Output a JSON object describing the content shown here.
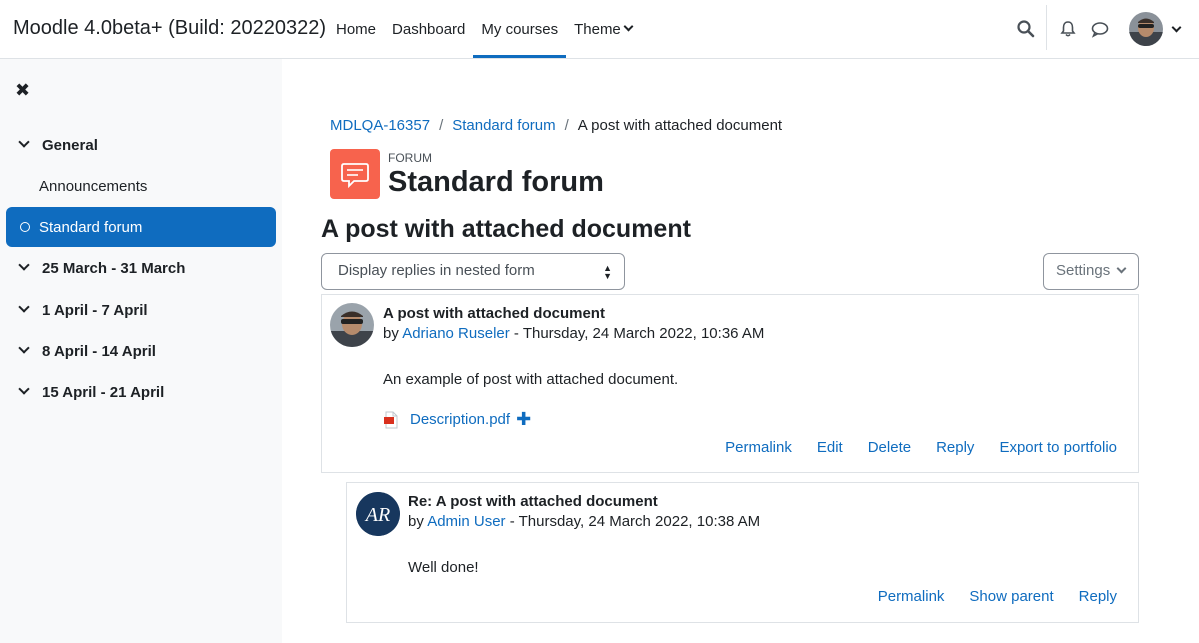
{
  "navbar": {
    "brand": "Moodle 4.0beta+ (Build: 20220322)",
    "links": [
      {
        "label": "Home"
      },
      {
        "label": "Dashboard"
      },
      {
        "label": "My courses",
        "active": true
      },
      {
        "label": "Theme",
        "dropdown": true
      }
    ],
    "icons": [
      "search-icon",
      "bell-icon",
      "message-icon"
    ]
  },
  "drawer": {
    "close_icon": "✖",
    "sections": [
      {
        "label": "General"
      },
      {
        "label": "25 March - 31 March"
      },
      {
        "label": "1 April - 7 April"
      },
      {
        "label": "8 April - 14 April"
      },
      {
        "label": "15 April - 21 April"
      }
    ],
    "activities": [
      {
        "label": "Announcements"
      },
      {
        "label": "Standard forum",
        "active": true
      }
    ]
  },
  "breadcrumb": [
    "MDLQA-16357",
    "Standard forum",
    "A post with attached document"
  ],
  "forum": {
    "label": "FORUM",
    "title": "Standard forum",
    "icon_color": "#f7634d"
  },
  "discussion": {
    "title": "A post with attached document",
    "display_mode": "Display replies in nested form",
    "settings_label": "Settings"
  },
  "posts": [
    {
      "subject": "A post with attached document",
      "by": "by",
      "author": "Adriano Ruseler",
      "date": "- Thursday, 24 March 2022, 10:36 AM",
      "body": "An example of post with attached document.",
      "attachment": "Description.pdf",
      "actions": [
        "Permalink",
        "Edit",
        "Delete",
        "Reply",
        "Export to portfolio"
      ]
    },
    {
      "subject": "Re: A post with attached document",
      "by": "by",
      "author": "Admin User",
      "date": "- Thursday, 24 March 2022, 10:38 AM",
      "body": "Well done!",
      "avatar_initials": "AR",
      "actions": [
        "Permalink",
        "Show parent",
        "Reply"
      ]
    }
  ],
  "colors": {
    "accent": "#0f6cbf",
    "drawer_bg": "#f8f9fa"
  }
}
